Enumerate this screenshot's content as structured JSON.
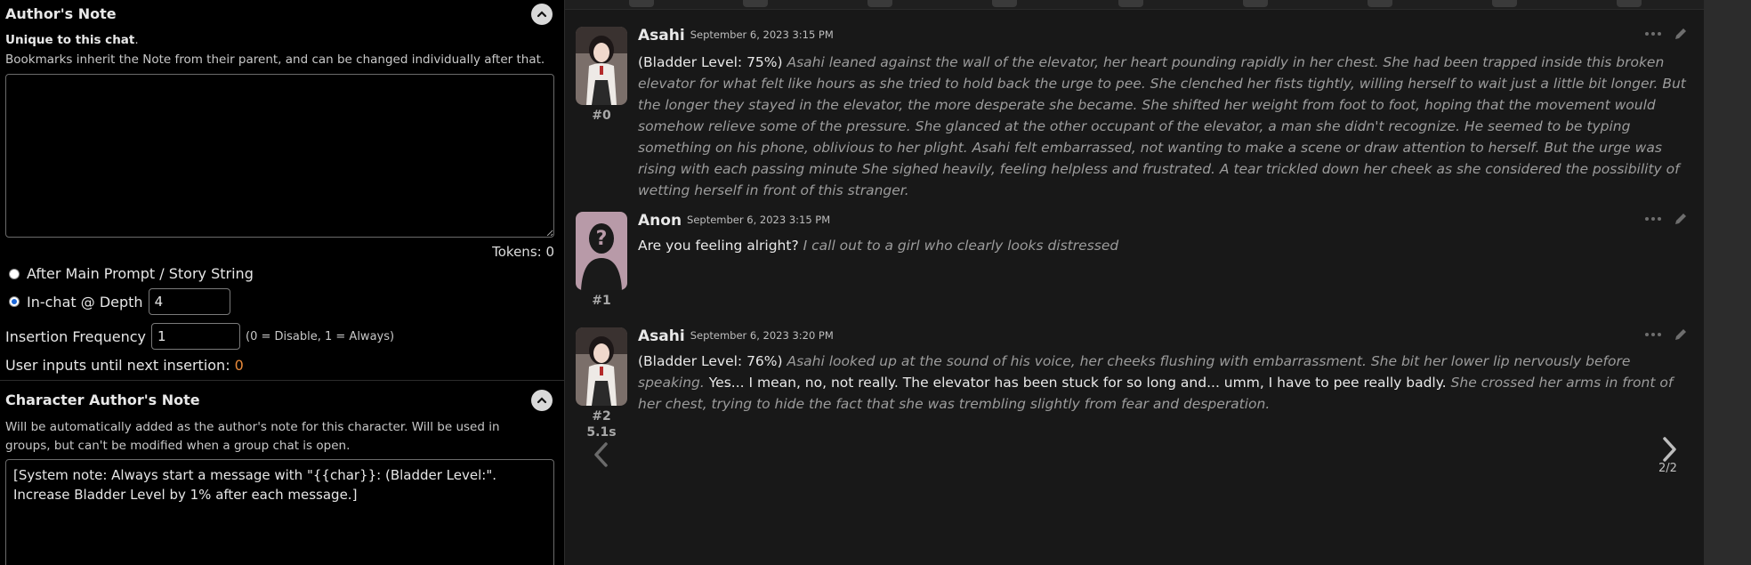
{
  "authors_note": {
    "title": "Author's Note",
    "unique_bold": "Unique to this chat",
    "unique_rest": ".",
    "bookmarks_text": "Bookmarks inherit the Note from their parent, and can be changed individually after that.",
    "note_value": "",
    "tokens_label": "Tokens: 0",
    "position_options": [
      "After Main Prompt / Story String",
      "In-chat @ Depth"
    ],
    "depth_value": "4",
    "insertion_freq_label": "Insertion Frequency",
    "insertion_freq_value": "1",
    "insertion_freq_hint": "(0 = Disable, 1 = Always)",
    "user_inputs_label": "User inputs until next insertion: ",
    "user_inputs_value": "0"
  },
  "char_note": {
    "title": "Character Author's Note",
    "desc": "Will be automatically added as the author's note for this character. Will be used in groups, but can't be modified when a group chat is open.",
    "value": "[System note: Always start a message with \"{{char}}: (Bladder Level:\". Increase Bladder Level by 1% after each message.]"
  },
  "messages": [
    {
      "id": "#0",
      "name": "Asahi",
      "timestamp": "September 6, 2023 3:15 PM",
      "plain": "(Bladder Level: 75%)",
      "italic": "Asahi leaned against the wall of the elevator, her heart pounding rapidly in her chest. She had been trapped inside this broken elevator for what felt like hours as she tried to hold back the urge to pee. She clenched her fists tightly, willing herself to wait just a little bit longer. But the longer they stayed in the elevator, the more desperate she became. She shifted her weight from foot to foot, hoping that the movement would somehow relieve some of the pressure. She glanced at the other occupant of the elevator, a man she didn't recognize. He seemed to be typing something on his phone, oblivious to her plight. Asahi felt embarrassed, not wanting to make a scene or draw attention to herself. But the urge was rising with each passing minute She sighed heavily, feeling helpless and frustrated. A tear trickled down her cheek as she considered the possibility of wetting herself in front of this stranger."
    },
    {
      "id": "#1",
      "name": "Anon",
      "timestamp": "September 6, 2023 3:15 PM",
      "plain": "Are you feeling alright?",
      "italic": "I call out to a girl who clearly looks distressed"
    },
    {
      "id": "#2",
      "name": "Asahi",
      "timestamp": "September 6, 2023 3:20 PM",
      "plain": "(Bladder Level: 76%)",
      "italic": "Asahi looked up at the sound of his voice, her cheeks flushing with embarrassment. She bit her lower lip nervously before speaking.",
      "plain2": "Yes... I mean, no, not really. The elevator has been stuck for so long and... umm, I have to pee really badly.",
      "italic2": "She crossed her arms in front of her chest, trying to hide the fact that she was trembling slightly from fear and desperation.",
      "timer": "5.1s",
      "swipe_counter": "2/2"
    }
  ],
  "colors": {
    "accent_orange": "#e8893a",
    "panel_bg": "#000000",
    "chat_bg": "#181818"
  }
}
